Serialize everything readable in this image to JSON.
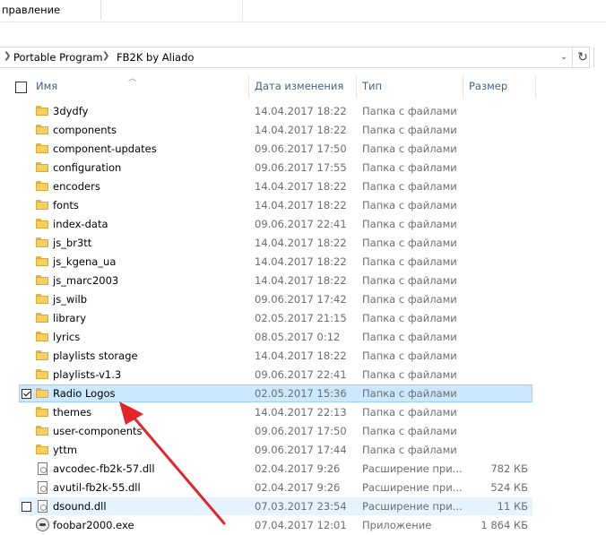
{
  "ribbon": {
    "command": "правление"
  },
  "address": {
    "crumbs": [
      "Portable Program",
      "FB2K by Aliado"
    ]
  },
  "columns": {
    "name": "Имя",
    "date": "Дата изменения",
    "type": "Тип",
    "size": "Размер"
  },
  "files": [
    {
      "name": "3dydfy",
      "date": "14.04.2017 18:22",
      "type": "Папка с файлами",
      "size": "",
      "icon": "folder-icon"
    },
    {
      "name": "components",
      "date": "14.04.2017 18:22",
      "type": "Папка с файлами",
      "size": "",
      "icon": "folder-icon"
    },
    {
      "name": "component-updates",
      "date": "09.06.2017 17:50",
      "type": "Папка с файлами",
      "size": "",
      "icon": "folder-icon"
    },
    {
      "name": "configuration",
      "date": "09.06.2017 17:55",
      "type": "Папка с файлами",
      "size": "",
      "icon": "folder-icon"
    },
    {
      "name": "encoders",
      "date": "14.04.2017 18:22",
      "type": "Папка с файлами",
      "size": "",
      "icon": "folder-icon"
    },
    {
      "name": "fonts",
      "date": "14.04.2017 18:22",
      "type": "Папка с файлами",
      "size": "",
      "icon": "folder-icon"
    },
    {
      "name": "index-data",
      "date": "09.06.2017 22:41",
      "type": "Папка с файлами",
      "size": "",
      "icon": "folder-icon"
    },
    {
      "name": "js_br3tt",
      "date": "14.04.2017 18:22",
      "type": "Папка с файлами",
      "size": "",
      "icon": "folder-icon"
    },
    {
      "name": "js_kgena_ua",
      "date": "14.04.2017 18:22",
      "type": "Папка с файлами",
      "size": "",
      "icon": "folder-icon"
    },
    {
      "name": "js_marc2003",
      "date": "14.04.2017 18:22",
      "type": "Папка с файлами",
      "size": "",
      "icon": "folder-icon"
    },
    {
      "name": "js_wilb",
      "date": "09.06.2017 17:42",
      "type": "Папка с файлами",
      "size": "",
      "icon": "folder-icon"
    },
    {
      "name": "library",
      "date": "02.05.2017 21:15",
      "type": "Папка с файлами",
      "size": "",
      "icon": "folder-icon"
    },
    {
      "name": "lyrics",
      "date": "08.05.2017 0:12",
      "type": "Папка с файлами",
      "size": "",
      "icon": "folder-icon"
    },
    {
      "name": "playlists storage",
      "date": "14.04.2017 18:22",
      "type": "Папка с файлами",
      "size": "",
      "icon": "folder-icon"
    },
    {
      "name": "playlists-v1.3",
      "date": "09.06.2017 22:41",
      "type": "Папка с файлами",
      "size": "",
      "icon": "folder-icon"
    },
    {
      "name": "Radio Logos",
      "date": "02.05.2017 15:36",
      "type": "Папка с файлами",
      "size": "",
      "icon": "folder-icon",
      "state": "selected"
    },
    {
      "name": "themes",
      "date": "14.04.2017 22:13",
      "type": "Папка с файлами",
      "size": "",
      "icon": "folder-icon"
    },
    {
      "name": "user-components",
      "date": "09.06.2017 17:50",
      "type": "Папка с файлами",
      "size": "",
      "icon": "folder-icon"
    },
    {
      "name": "yttm",
      "date": "09.06.2017 17:44",
      "type": "Папка с файлами",
      "size": "",
      "icon": "folder-icon"
    },
    {
      "name": "avcodec-fb2k-57.dll",
      "date": "02.04.2017 9:26",
      "type": "Расширение при...",
      "size": "782 КБ",
      "icon": "dll-file-icon"
    },
    {
      "name": "avutil-fb2k-55.dll",
      "date": "02.04.2017 9:26",
      "type": "Расширение при...",
      "size": "524 КБ",
      "icon": "dll-file-icon"
    },
    {
      "name": "dsound.dll",
      "date": "07.03.2017 23:54",
      "type": "Расширение при...",
      "size": "11 КБ",
      "icon": "dll-file-icon",
      "state": "hover"
    },
    {
      "name": "foobar2000.exe",
      "date": "07.04.2017 12:01",
      "type": "Приложение",
      "size": "1 864 КБ",
      "icon": "foobar-app-icon"
    }
  ],
  "colors": {
    "selection": "#cce8ff",
    "selection_border": "#99d1ff",
    "hover": "#e5f3ff",
    "arrow": "#e0262b",
    "header_text": "#4c607a"
  }
}
